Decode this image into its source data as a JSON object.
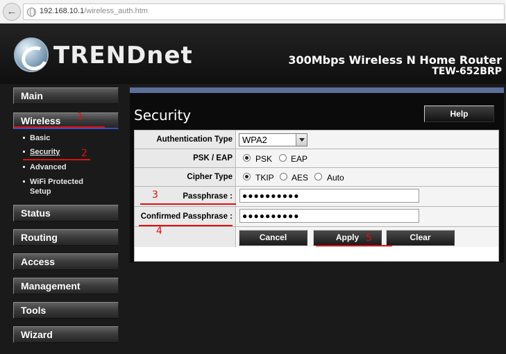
{
  "browser": {
    "url_host": "192.168.10.1",
    "url_path": "/wireless_auth.htm"
  },
  "header": {
    "brand": "TRENDnet",
    "product_title": "300Mbps Wireless N Home Router",
    "model": "TEW-652BRP"
  },
  "nav": {
    "main": "Main",
    "wireless": "Wireless",
    "sub": {
      "basic": "Basic",
      "security": "Security",
      "advanced": "Advanced",
      "wps_line1": "WiFi Protected",
      "wps_line2": "Setup"
    },
    "status": "Status",
    "routing": "Routing",
    "access": "Access",
    "management": "Management",
    "tools": "Tools",
    "wizard": "Wizard"
  },
  "panel": {
    "title": "Security",
    "help": "Help"
  },
  "form": {
    "auth_type_label": "Authentication Type",
    "auth_type_value": "WPA2",
    "psk_eap_label": "PSK / EAP",
    "psk_option": "PSK",
    "eap_option": "EAP",
    "psk_eap_selected": "PSK",
    "cipher_label": "Cipher Type",
    "tkip_option": "TKIP",
    "aes_option": "AES",
    "auto_option": "Auto",
    "cipher_selected": "TKIP",
    "passphrase_label": "Passphrase :",
    "passphrase_value": "●●●●●●●●●●",
    "confirm_label": "Confirmed Passphrase :",
    "confirm_value": "●●●●●●●●●●"
  },
  "actions": {
    "cancel": "Cancel",
    "apply": "Apply",
    "clear": "Clear"
  },
  "annotations": {
    "n1": "1",
    "n2": "2",
    "n3": "3",
    "n4": "4",
    "n5": "5",
    "color": "#e01010"
  },
  "colors": {
    "panel_bar": "#5c6f98",
    "active_underline": "#3a4ec0"
  }
}
